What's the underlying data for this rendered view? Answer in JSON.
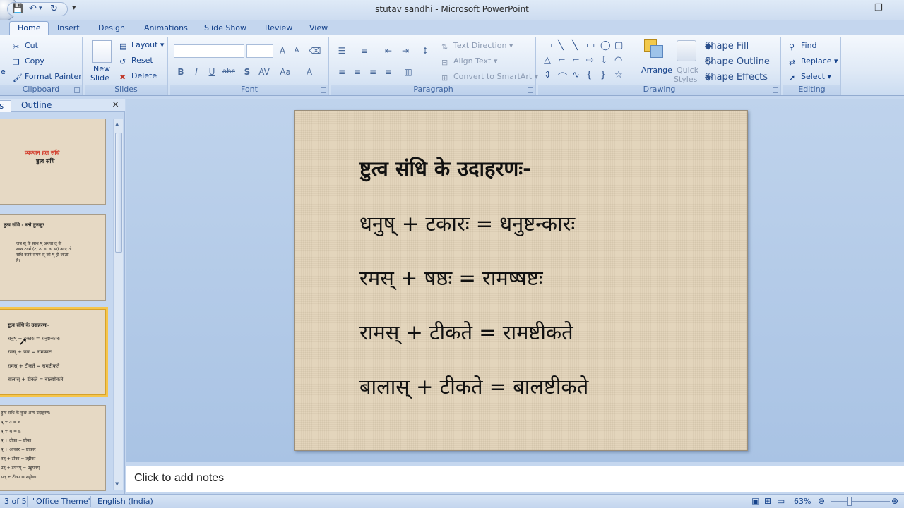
{
  "window": {
    "title": "stutav sandhi - Microsoft PowerPoint"
  },
  "tabs": [
    "Home",
    "Insert",
    "Design",
    "Animations",
    "Slide Show",
    "Review",
    "View"
  ],
  "ribbon": {
    "clipboard": {
      "label": "Clipboard",
      "cut": "Cut",
      "copy": "Copy",
      "format_painter": "Format Painter",
      "paste_partial": "e"
    },
    "slides": {
      "label": "Slides",
      "new_slide_line1": "New",
      "new_slide_line2": "Slide",
      "layout": "Layout",
      "reset": "Reset",
      "delete": "Delete"
    },
    "font": {
      "label": "Font",
      "bold": "B",
      "italic": "I",
      "underline": "U",
      "shadow": "S",
      "strike": "abc"
    },
    "paragraph": {
      "label": "Paragraph",
      "text_direction": "Text Direction",
      "align_text": "Align Text",
      "convert_smartart": "Convert to SmartArt"
    },
    "drawing": {
      "label": "Drawing",
      "arrange": "Arrange",
      "quick_styles_line1": "Quick",
      "quick_styles_line2": "Styles",
      "shape_fill": "Shape Fill",
      "shape_outline": "Shape Outline",
      "shape_effects": "Shape Effects"
    },
    "editing": {
      "label": "Editing",
      "find": "Find",
      "replace": "Replace",
      "select": "Select"
    }
  },
  "slides_pane": {
    "tab_slides_partial": "s",
    "tab_outline": "Outline",
    "thumbnails": [
      {
        "lines": [
          "व्यञ्जन हल संधि",
          "ष्टुत्व संधि"
        ]
      },
      {
        "lines": [
          "ष्टुत्व संधि - स्तो ष्टुनाष्टुः",
          "जब स् के साथ ष् अथवा त् के",
          "साथ टवर्ग (ट, ठ, ड, ढ, ण) आए तो",
          "संधि करने समय स् को ष् हो जाता",
          "है।"
        ]
      },
      {
        "lines": [
          "ष्टुत्व संधि के उदाहरणः-",
          "धनुष् + टकारः = धनुष्टन्कारः",
          "रमस् + षष्ठः = रामष्षष्टः",
          "रामस् + टीकते = रामष्टीकते",
          "बालास् + टीकते = बालष्टीकते"
        ]
      },
      {
        "lines": [
          "ष्टुत्व संधि के कुछ अन्य उदाहरण:-",
          "ष् + त = ष्ट",
          "ष् + थ = ष्ठ",
          "ष् + टीका = ष्टीका",
          "ष् + आकार = ष्टाकार",
          "तत् + टीका = तट्टीका",
          "उत् + डयनम् = उड्डयनम्",
          "सत् + टीका = सट्टीका"
        ]
      }
    ]
  },
  "slide": {
    "heading": "ष्टुत्व संधि के उदाहरणः-",
    "lines": [
      "धनुष्  +  टकारः  =  धनुष्टन्कारः",
      "रमस्    +  षष्ठः  =  रामष्षष्टः",
      "रामस्    +  टीकते  =  रामष्टीकते",
      "बालास्  +  टीकते  =  बालष्टीकते"
    ]
  },
  "notes": {
    "placeholder": "Click to add notes"
  },
  "status": {
    "slide_counter": "3 of 5",
    "theme": "\"Office Theme\"",
    "language": "English (India)",
    "zoom": "63%"
  }
}
